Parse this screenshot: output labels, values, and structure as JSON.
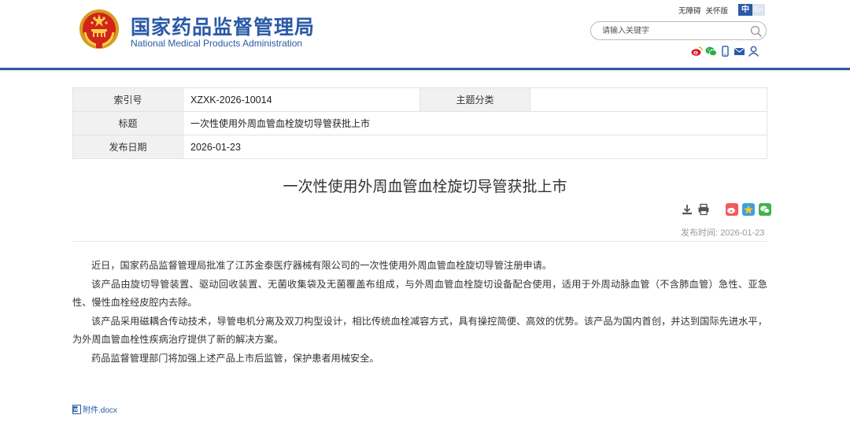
{
  "header": {
    "logo_cn": "国家药品监督管理局",
    "logo_en": "National Medical Products Administration",
    "top_links": [
      "无障碍",
      "关怀版"
    ],
    "lang_zh": "中",
    "lang_en": "En",
    "search_placeholder": "请输入关键字",
    "social_icons": [
      "weibo-icon",
      "wechat-icon",
      "mobile-icon",
      "mail-icon",
      "user-icon"
    ],
    "brand_color": "#2a5aa6"
  },
  "meta": {
    "index_label": "索引号",
    "index_value": "XZXK-2026-10014",
    "topic_label": "主题分类",
    "topic_value": "",
    "title_label": "标题",
    "title_value": "一次性使用外周血管血栓旋切导管获批上市",
    "date_label": "发布日期",
    "date_value": "2026-01-23"
  },
  "article": {
    "title": "一次性使用外周血管血栓旋切导管获批上市",
    "tool_icons": [
      "download-icon",
      "print-icon",
      "weibo-share-icon",
      "qzone-share-icon",
      "wechat-share-icon"
    ],
    "published": "发布时间:  2026-01-23",
    "paragraphs": [
      "近日，国家药品监督管理局批准了江苏金泰医疗器械有限公司的一次性使用外周血管血栓旋切导管注册申请。",
      "该产品由旋切导管装置、驱动回收装置、无菌收集袋及无菌覆盖布组成，与外周血管血栓旋切设备配合使用，适用于外周动脉血管（不含肺血管）急性、亚急性、慢性血栓经皮腔内去除。",
      "该产品采用磁耦合传动技术，导管电机分离及双刀构型设计，相比传统血栓减容方式，具有操控简便、高效的优势。该产品为国内首创，并达到国际先进水平，为外周血管血栓性疾病治疗提供了新的解决方案。",
      "药品监督管理部门将加强上述产品上市后监管，保护患者用械安全。"
    ],
    "attachment": "附件.docx"
  }
}
